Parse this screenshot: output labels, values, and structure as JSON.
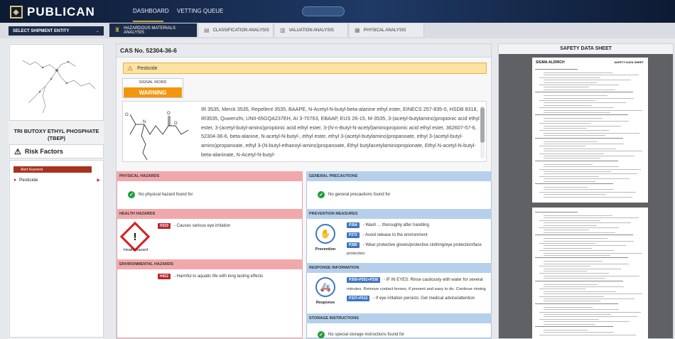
{
  "header": {
    "logo_text": "PUBLICAN",
    "nav": [
      "DASHBOARD",
      "VETTING QUEUE"
    ]
  },
  "subnav": {
    "selector_label": "SELECT SHIPMENT ENTITY",
    "tabs": [
      "HAZARDOUS MATERIALS ANALYSIS",
      "CLASSIFICATION ANALYSIS",
      "VALUATION ANALYSIS",
      "PHYSICAL ANALYSIS"
    ]
  },
  "left": {
    "chemical_name": "TRI BUTOXY ETHYL PHOSPHATE (TBEP)",
    "risk_title": "Risk Factors",
    "alert_label": "Alert Keyword",
    "risk_item": "Pesticide"
  },
  "main": {
    "cas": "CAS No. 52304-36-6",
    "category": "Pesticide",
    "signal_word_label": "SIGNAL WORD",
    "signal_word": "WARNING",
    "synonyms": "IR 3535, Merck 3535, Repellent 3535, BAAPE, N-Acetyl-N-butyl-beta-alanine ethyl ester, EINECS 257-835-0, HSDB 8318, IR3535, Quwenzhi, UNII-65GQA237EH, AI 3-70763, EBAAP, EUS 26-15, M-3535, 3-(acetyl-butylamino)propionic acid ethyl ester, 3-(acetyl-butyl-amino)propionic acid ethyl ester, 3-(N-n-Butyl-N-acetyl)aminopropionic acid ethyl ester, 362607-57-6, 52304-36-6, beta-alanine, N-acetyl-N-butyl-, ethyl ester, ethyl 3-(acetyl-butylamino)propanoate, ethyl 3-(acetyl-butyl-amino)propanoate, ethyl 3-(N-butyl-ethanoyl-amino)propanoate, Ethyl butylacetylaminopropionate, Ethyl N-acetyl-N-butyl-beta-alaninate, N-Acetyl-N-butyl-",
    "physical_hazards": {
      "title": "PHYSICAL HAZARDS",
      "text": "No physical hazard found for"
    },
    "health_hazards": {
      "title": "HEALTH HAZARDS",
      "code": "H319",
      "text": "- Causes serious eye irritation",
      "pictogram_label": "Health hazard"
    },
    "environmental_hazards": {
      "title": "ENVIRONMENTAL HAZARDS",
      "code": "H412",
      "text": "- Harmful to aquatic life with long lasting effects"
    },
    "general_precautions": {
      "title": "GENERAL PRECAUTIONS",
      "text": "No general precautions found for"
    },
    "prevention": {
      "title": "PREVENTION MEASURES",
      "label": "Prevention",
      "items": [
        {
          "code": "P264",
          "text": "- Wash ... thoroughly after handling"
        },
        {
          "code": "P273",
          "text": "- Avoid release to the environment"
        },
        {
          "code": "P280",
          "text": "- Wear protective gloves/protective clothing/eye protection/face",
          "cont": "protection"
        }
      ]
    },
    "response": {
      "title": "RESPONSE INFORMATION",
      "label": "Response",
      "items": [
        {
          "code": "P305+P351+P338",
          "text": "- IF IN EYES: Rinse cautiously with water for several",
          "cont": "minutes. Remove contact lenses, if present and easy to do. Continue rinsing"
        },
        {
          "code": "P337+P313",
          "text": "- If eye irritation persists: Get medical advice/attention"
        }
      ]
    },
    "storage": {
      "title": "STORAGE INSTRUCTIONS",
      "text": "No special storage instructions found for"
    }
  },
  "sds": {
    "title": "SAFETY DATA SHEET",
    "brand": "SIGMA-ALDRICH",
    "page_title": "SAFETY DATA SHEET"
  },
  "colors": {
    "navy": "#1b2b48",
    "gold": "#c7a43c",
    "warning": "#f2960e",
    "danger": "#b8262b",
    "info": "#3e76c1",
    "ok": "#1f9e3a"
  }
}
